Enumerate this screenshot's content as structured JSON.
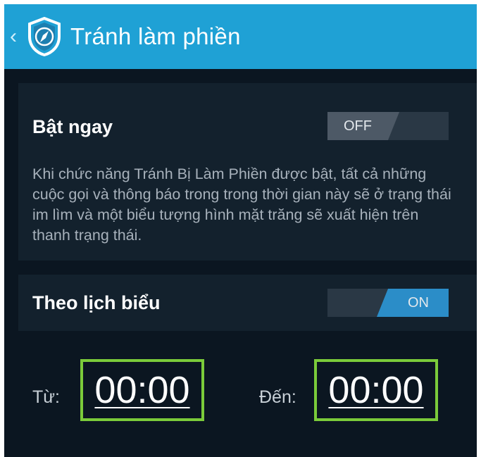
{
  "header": {
    "back_icon": "chevron-left-icon",
    "app_icon": "shield-compass-icon",
    "title": "Tránh làm phiền",
    "colors": {
      "background": "#1fa1d5",
      "text": "#ffffff"
    }
  },
  "enable_now": {
    "label": "Bật ngay",
    "toggle_state": "OFF",
    "description": "Khi chức năng Tránh Bị Làm Phiền được bật, tất cả những cuộc gọi và thông báo trong trong thời gian này sẽ ở trạng thái im lìm và một biểu tượng hình mặt trăng sẽ xuất hiện trên thanh trạng thái."
  },
  "schedule": {
    "label": "Theo lịch biểu",
    "toggle_state": "ON",
    "from_label": "Từ:",
    "from_time": "00:00",
    "to_label": "Đến:",
    "to_time": "00:00"
  },
  "colors": {
    "screen_background": "#0b1621",
    "card_background": "#13212d",
    "toggle_on": "#2b8dc8",
    "toggle_off": "#4d5966",
    "highlight_border": "#7bcb3a"
  }
}
